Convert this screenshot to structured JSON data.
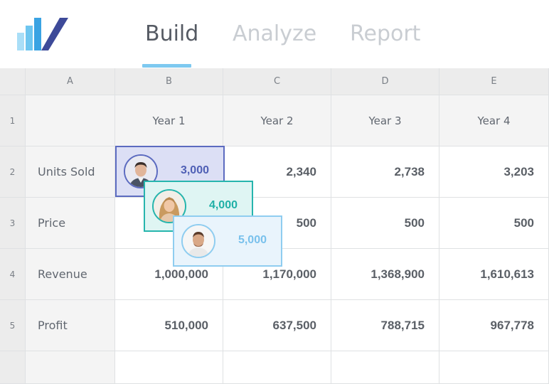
{
  "tabs": [
    {
      "label": "Build",
      "active": true
    },
    {
      "label": "Analyze",
      "active": false
    },
    {
      "label": "Report",
      "active": false
    }
  ],
  "columns": [
    "A",
    "B",
    "C",
    "D",
    "E"
  ],
  "row_numbers": [
    "1",
    "2",
    "3",
    "4",
    "5",
    ""
  ],
  "year_headers": [
    "Year 1",
    "Year 2",
    "Year 3",
    "Year 4"
  ],
  "rows": [
    {
      "label": "Units Sold",
      "values": [
        "3,000",
        "2,340",
        "2,738",
        "3,203"
      ]
    },
    {
      "label": "Price",
      "values": [
        "",
        "500",
        "500",
        "500"
      ]
    },
    {
      "label": "Revenue",
      "values": [
        "1,000,000",
        "1,170,000",
        "1,368,900",
        "1,610,613"
      ]
    },
    {
      "label": "Profit",
      "values": [
        "510,000",
        "637,500",
        "788,715",
        "967,778"
      ]
    }
  ],
  "cards": [
    {
      "value": "3,000",
      "color": "#5c6bc0"
    },
    {
      "value": "4,000",
      "color": "#26b5ad"
    },
    {
      "value": "5,000",
      "color": "#8fcdf0"
    }
  ],
  "colors": {
    "tab_indicator": "#7ec9f0",
    "logo_dark": "#3d4a99",
    "logo_light": "#7ec9f0"
  }
}
